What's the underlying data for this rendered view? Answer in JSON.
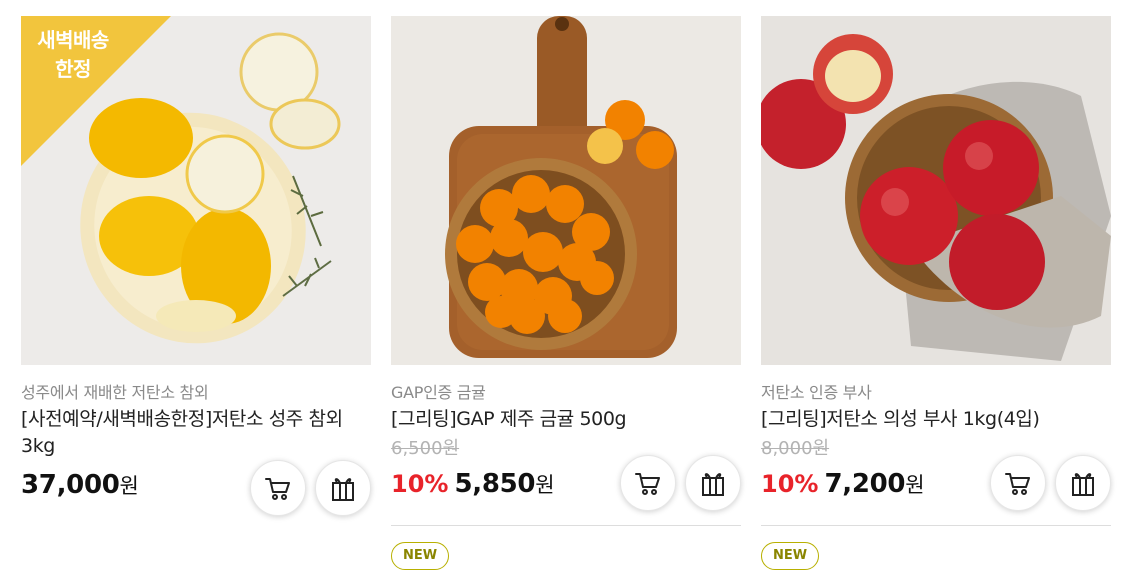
{
  "products": [
    {
      "ribbon": "새벽배송\n한정",
      "subtitle": "성주에서 재배한 저탄소 참외",
      "title": "[사전예약/새벽배송한정]저탄소 성주 참외 3kg",
      "original_price": "",
      "discount_rate": "",
      "price": "37,000",
      "unit": "원",
      "badge": ""
    },
    {
      "subtitle": "GAP인증 금귤",
      "title": "[그리팅]GAP 제주 금귤 500g",
      "original_price": "6,500원",
      "discount_rate": "10%",
      "price": "5,850",
      "unit": "원",
      "badge": "NEW"
    },
    {
      "subtitle": "저탄소 인증 부사",
      "title": "[그리팅]저탄소 의성 부사 1kg(4입)",
      "original_price": "8,000원",
      "discount_rate": "10%",
      "price": "7,200",
      "unit": "원",
      "badge": "NEW"
    }
  ],
  "icons": {
    "cart": "cart-icon",
    "gift": "gift-icon"
  },
  "colors": {
    "discount": "#e8232a",
    "ribbon": "#f2c53d",
    "badge": "#b8b000"
  }
}
